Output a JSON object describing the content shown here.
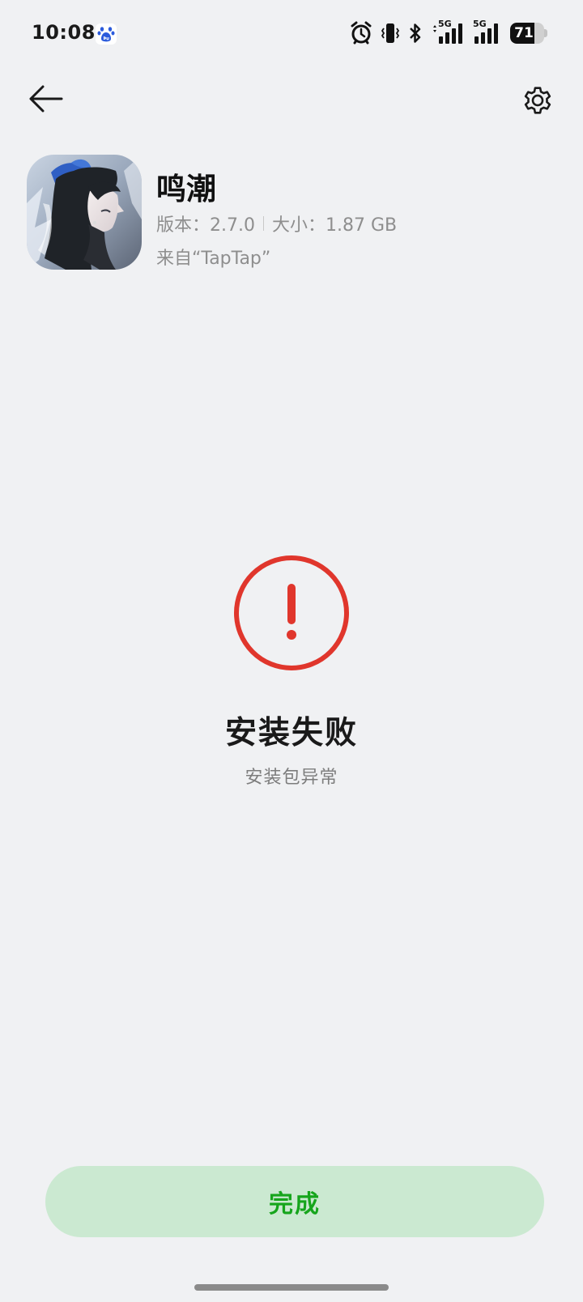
{
  "status_bar": {
    "time": "10:08",
    "network_label_1": "5G",
    "network_label_2": "5G",
    "battery_level": "71",
    "battery_fraction": 0.71,
    "icons": [
      "baidu-icon",
      "alarm-icon",
      "vibrate-icon",
      "bluetooth-icon",
      "signal-icon",
      "signal-icon",
      "battery-icon"
    ]
  },
  "toolbar": {
    "back_icon": "arrow-left-icon",
    "settings_icon": "gear-icon"
  },
  "app": {
    "name": "鸣潮",
    "version_text": "版本：2.7.0",
    "size_text": "大小：1.87 GB",
    "source_text": "来自“TapTap”"
  },
  "result": {
    "icon": "exclamation-circle-icon",
    "title": "安装失败",
    "subtitle": "安装包异常"
  },
  "footer": {
    "done_label": "完成"
  },
  "colors": {
    "background": "#f0f1f3",
    "error": "#e0362c",
    "button_bg": "#cbe9d1",
    "button_text": "#16a51c"
  }
}
